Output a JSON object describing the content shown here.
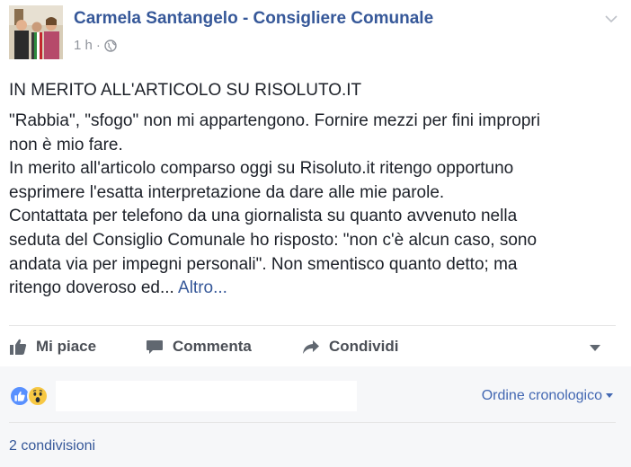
{
  "post": {
    "author": "Carmela Santangelo - Consigliere Comunale",
    "time": "1 h",
    "separator": "·",
    "headline": "IN MERITO ALL'ARTICOLO SU RISOLUTO.IT",
    "body_lines": [
      "\"Rabbia\", \"sfogo\" non mi appartengono. Fornire mezzi per fini impropri",
      "non è mio fare.",
      "In merito all'articolo comparso oggi su Risoluto.it ritengo opportuno",
      "esprimere l'esatta interpretazione da dare alle mie parole.",
      "Contattata per telefono da una giornalista su quanto avvenuto nella",
      "seduta del Consiglio Comunale ho risposto: \"non c'è alcun caso, sono",
      "andata via per impegni personali\". Non smentisco quanto detto; ma",
      "ritengo doveroso ed..."
    ],
    "more_label": "Altro..."
  },
  "actions": {
    "like_label": "Mi piace",
    "comment_label": "Commenta",
    "share_label": "Condividi"
  },
  "footer": {
    "order_label": "Ordine cronologico",
    "shares_label": "2 condivisioni"
  },
  "icons": {
    "audience": "globe-icon",
    "like": "thumbs-up-icon",
    "comment": "speech-bubble-icon",
    "share": "share-arrow-icon",
    "reaction_1": "like-reaction-icon",
    "reaction_2": "wow-reaction-icon"
  },
  "colors": {
    "link": "#365899",
    "text": "#1d2129",
    "muted": "#90949c",
    "action": "#4b4f56",
    "like_blue": "#5890ff",
    "wow_yellow": "#f7c844"
  }
}
